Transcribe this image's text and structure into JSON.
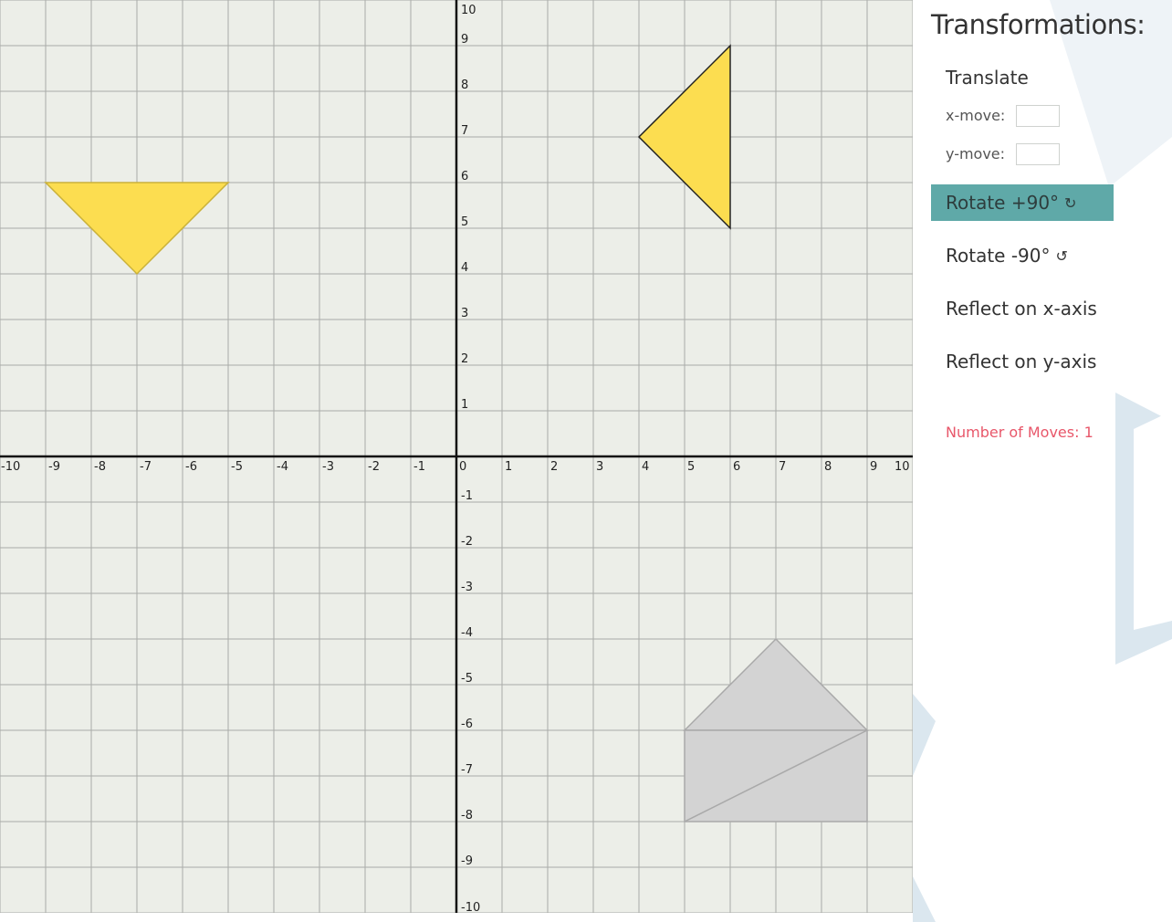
{
  "panel": {
    "title": "Transformations:",
    "translate_label": "Translate",
    "x_move_label": "x-move:",
    "x_move_value": "",
    "y_move_label": "y-move:",
    "y_move_value": "",
    "rotate_cw_label": "Rotate +90°",
    "rotate_cw_icon": "rotate-clockwise-icon",
    "rotate_cw_glyph": "↻",
    "rotate_ccw_label": "Rotate -90°",
    "rotate_ccw_icon": "rotate-counterclockwise-icon",
    "rotate_ccw_glyph": "↺",
    "reflect_x_label": "Reflect on x-axis",
    "reflect_y_label": "Reflect on y-axis",
    "active_button": "rotate-plus-90",
    "moves_label": "Number of Moves:",
    "moves_count": "1"
  },
  "grid": {
    "x_range": [
      -10,
      10
    ],
    "y_range": [
      -10,
      10
    ],
    "x_ticks": [
      -10,
      -9,
      -8,
      -7,
      -6,
      -5,
      -4,
      -3,
      -2,
      -1,
      0,
      1,
      2,
      3,
      4,
      5,
      6,
      7,
      8,
      9,
      10
    ],
    "y_ticks": [
      10,
      9,
      8,
      7,
      6,
      5,
      4,
      3,
      2,
      1,
      -1,
      -2,
      -3,
      -4,
      -5,
      -6,
      -7,
      -8,
      -9,
      -10
    ]
  },
  "shapes": {
    "target_outline": {
      "color": "#d3d3d3",
      "stroke": "#a9a9a9",
      "polygons": [
        [
          [
            5,
            -6
          ],
          [
            7,
            -4
          ],
          [
            9,
            -6
          ]
        ],
        [
          [
            5,
            -6
          ],
          [
            9,
            -6
          ],
          [
            9,
            -8
          ],
          [
            5,
            -8
          ]
        ],
        [
          [
            5,
            -8
          ],
          [
            9,
            -6
          ]
        ]
      ]
    },
    "pieces": [
      {
        "name": "triangle-piece-left",
        "color": "#fcdd50",
        "stroke": "#c9b13a",
        "points": [
          [
            -9,
            6
          ],
          [
            -5,
            6
          ],
          [
            -7,
            4
          ]
        ]
      },
      {
        "name": "triangle-piece-right",
        "color": "#fcdd50",
        "stroke": "#222222",
        "points": [
          [
            6,
            9
          ],
          [
            6,
            5
          ],
          [
            4,
            7
          ]
        ]
      }
    ]
  },
  "colors": {
    "board_background": "#eceee8",
    "grid_line": "#a9aba8",
    "axis_line": "#111111",
    "active_button": "#5fa9a8",
    "moves_text": "#e8576a"
  }
}
